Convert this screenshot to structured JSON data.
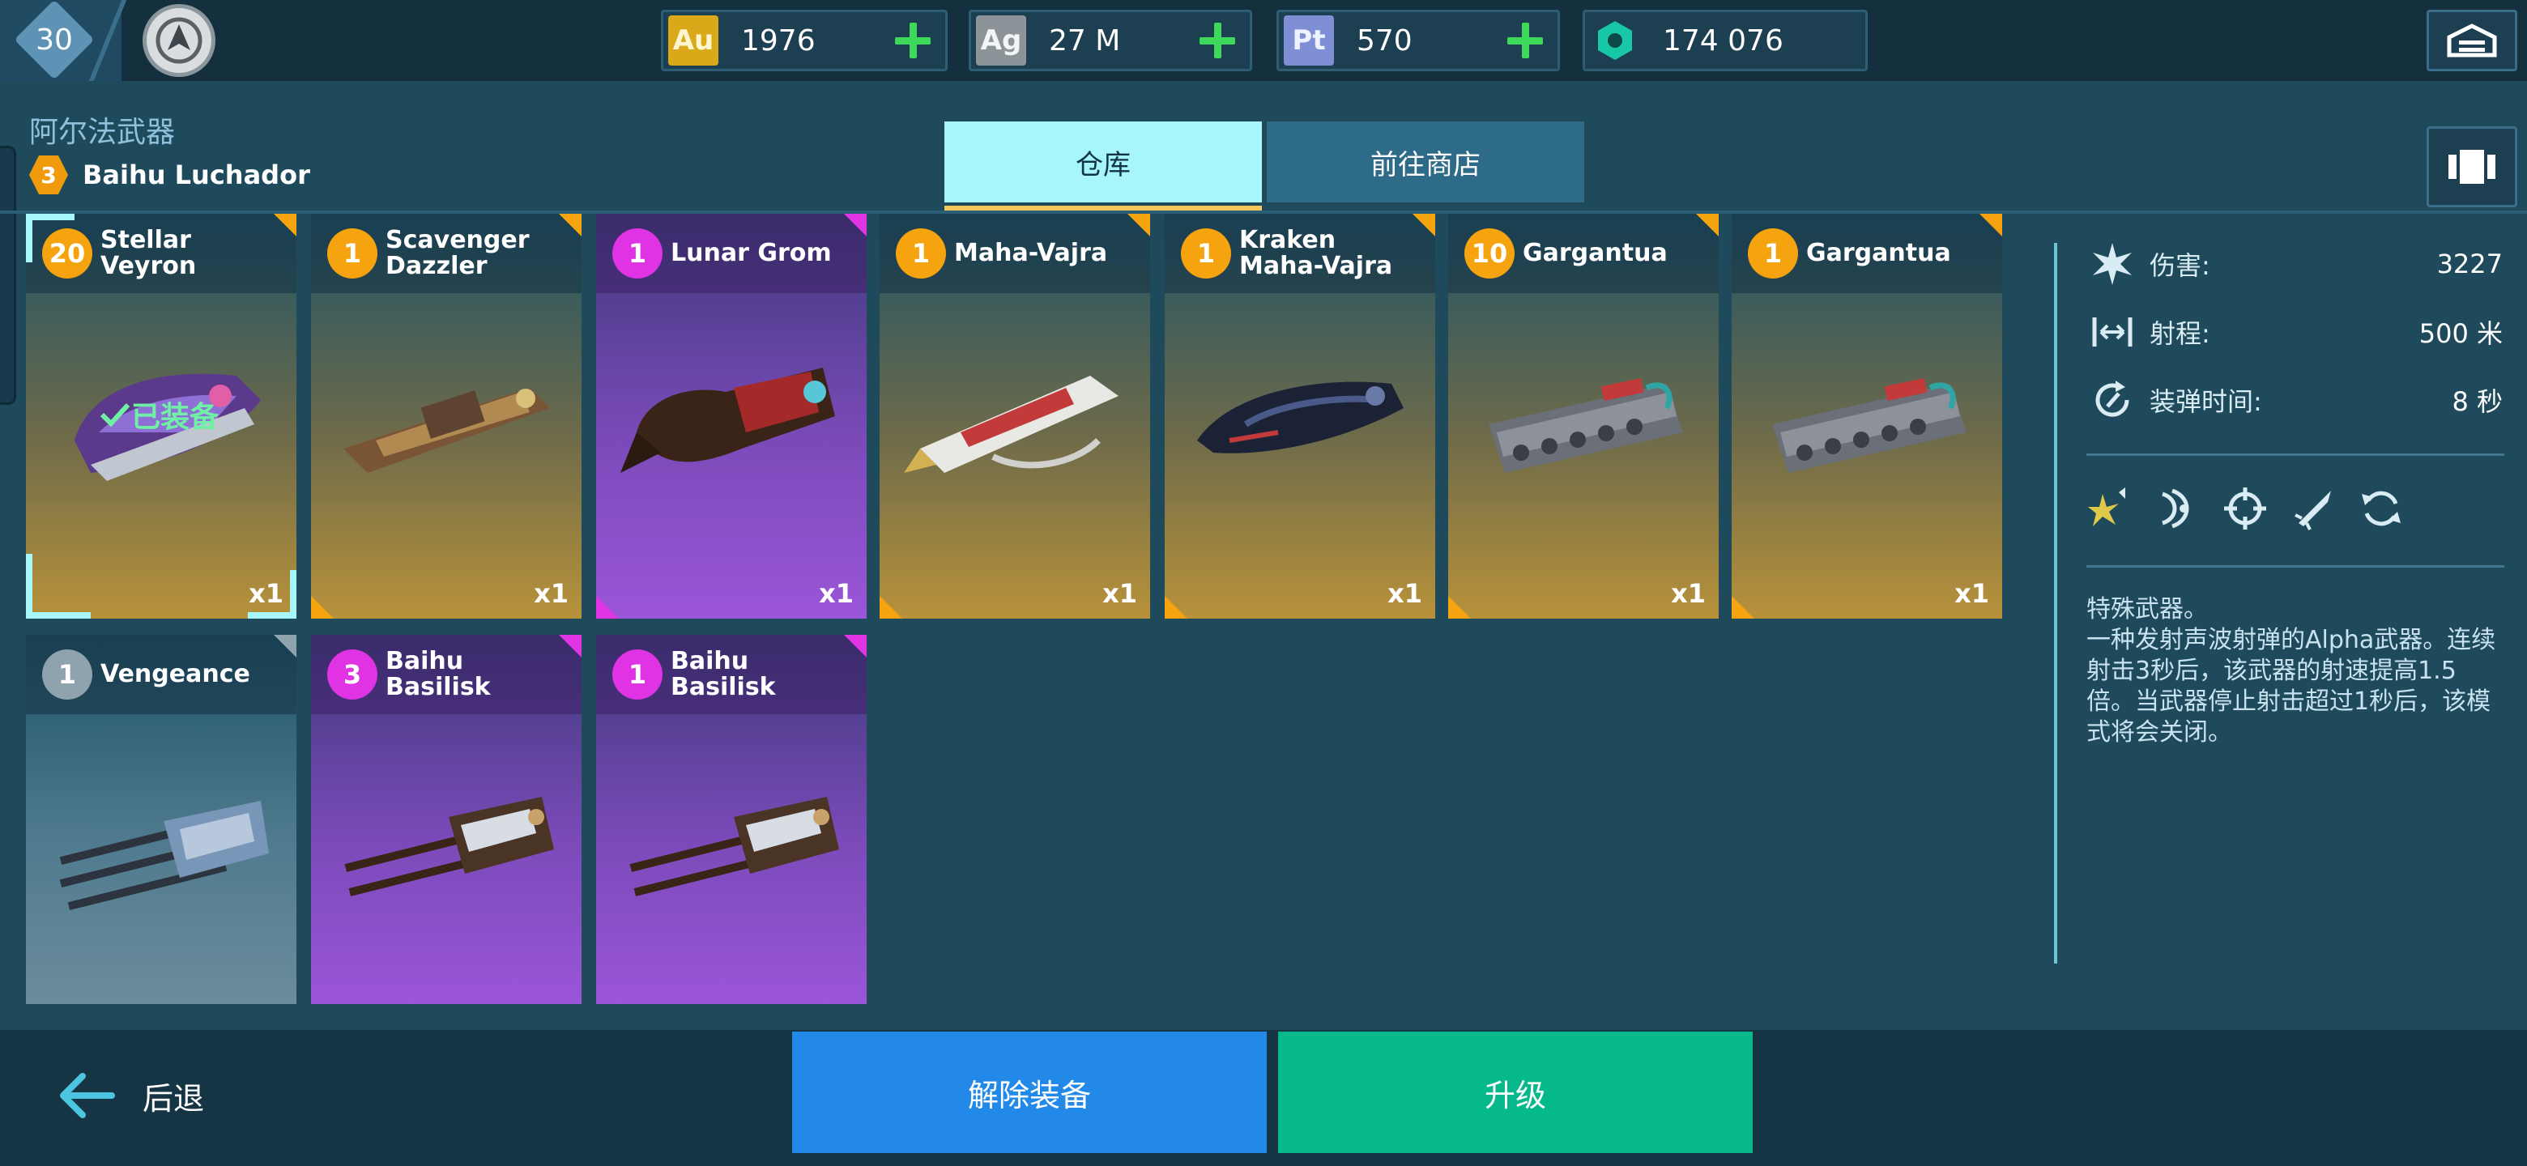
{
  "topbar": {
    "level": "30",
    "currencies": [
      {
        "code": "Au",
        "value": "1976",
        "badge_color": "#d9a91a",
        "text_color": "#ffffff"
      },
      {
        "code": "Ag",
        "value": "27 M",
        "badge_color": "#8c9499",
        "text_color": "#ffffff"
      },
      {
        "code": "Pt",
        "value": "570",
        "badge_color": "#7e8fd6",
        "text_color": "#ffffff"
      },
      {
        "code": "",
        "value": "174 076",
        "badge_color": "#17c7a5",
        "text_color": "#ffffff"
      }
    ]
  },
  "header": {
    "section_title": "阿尔法武器",
    "robot_level": "3",
    "robot_name": "Baihu Luchador"
  },
  "tabs": {
    "active": "仓库",
    "inactive": "前往商店"
  },
  "cards": [
    {
      "level": "20",
      "name": "Stellar Veyron",
      "qty": "x1",
      "rarity": "gold",
      "equipped": true,
      "equipped_label": "已装备"
    },
    {
      "level": "1",
      "name": "Scavenger Dazzler",
      "qty": "x1",
      "rarity": "gold"
    },
    {
      "level": "1",
      "name": "Lunar Grom",
      "qty": "x1",
      "rarity": "purple"
    },
    {
      "level": "1",
      "name": "Maha-Vajra",
      "qty": "x1",
      "rarity": "gold"
    },
    {
      "level": "1",
      "name": "Kraken Maha-Vajra",
      "qty": "x1",
      "rarity": "gold"
    },
    {
      "level": "10",
      "name": "Gargantua",
      "qty": "x1",
      "rarity": "gold"
    },
    {
      "level": "1",
      "name": "Gargantua",
      "qty": "x1",
      "rarity": "gold"
    },
    {
      "level": "1",
      "name": "Vengeance",
      "qty": "",
      "rarity": "gray"
    },
    {
      "level": "3",
      "name": "Baihu Basilisk",
      "qty": "",
      "rarity": "purple"
    },
    {
      "level": "1",
      "name": "Baihu Basilisk",
      "qty": "",
      "rarity": "purple"
    }
  ],
  "stats": {
    "damage_label": "伤害:",
    "damage_value": "3227",
    "range_label": "射程:",
    "range_value": "500 米",
    "reload_label": "装弹时间:",
    "reload_value": "8 秒"
  },
  "abilities": [
    "star-burst-icon",
    "sonic-wave-icon",
    "crosshair-icon",
    "missile-icon",
    "refresh-icon"
  ],
  "description": {
    "title": "特殊武器。",
    "body": "一种发射声波射弹的Alpha武器。连续射击3秒后，该武器的射速提高1.5倍。当武器停止射击超过1秒后，该模式将会关闭。"
  },
  "bottom": {
    "back_label": "后退",
    "unequip_label": "解除装备",
    "upgrade_label": "升级"
  },
  "colors": {
    "gold_level": "#f5a30e",
    "purple_level": "#e033e3",
    "gray_level": "#8fa3ae",
    "gold_corner": "#f5a30e",
    "purple_corner": "#e033e3"
  }
}
